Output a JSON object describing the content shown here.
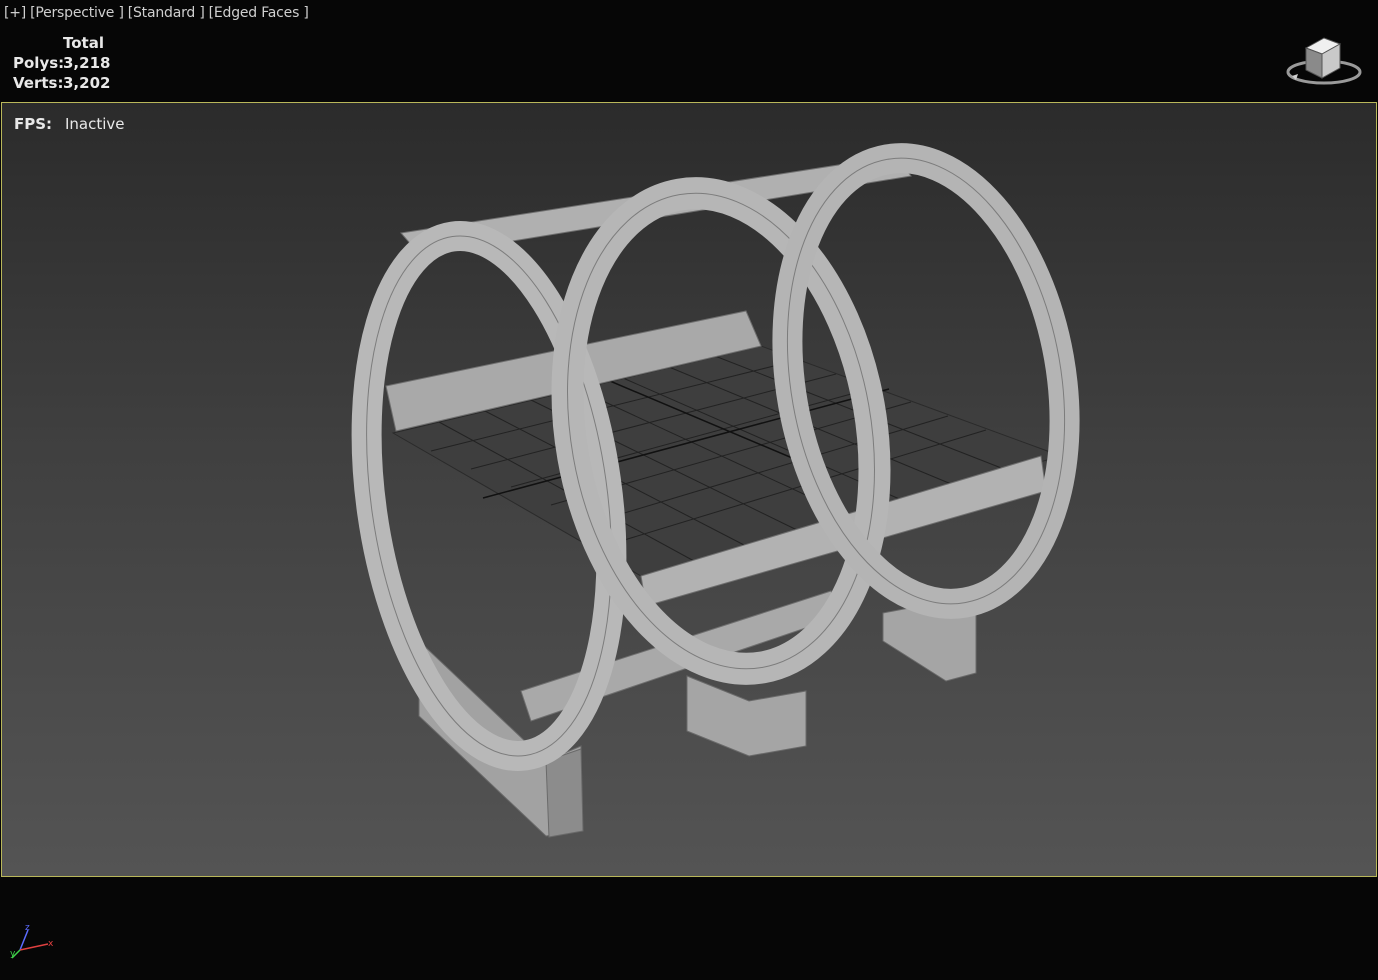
{
  "viewport": {
    "plus": "[+]",
    "view": "[Perspective ]",
    "shading": "[Standard ]",
    "edges": "[Edged Faces ]"
  },
  "stats": {
    "header": "Total",
    "polys_label": "Polys:",
    "polys_value": "3,218",
    "verts_label": "Verts:",
    "verts_value": "3,202"
  },
  "fps": {
    "label": "FPS:",
    "value": "Inactive"
  },
  "axis": {
    "z": "z",
    "x": "x",
    "y": "y"
  },
  "icons": {
    "viewcube": "viewcube-icon",
    "axis_tripod": "axis-tripod-icon"
  },
  "colors": {
    "frame_border": "#b9b75a",
    "model": "#a8a8a8",
    "wire": "#7a7a7a",
    "grid": "#1e1e1e"
  }
}
